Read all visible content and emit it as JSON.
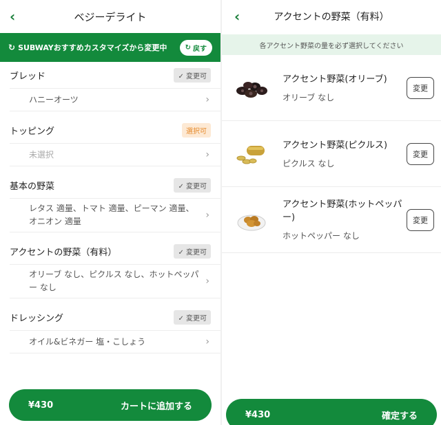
{
  "left": {
    "title": "ベジーデライト",
    "back_icon": "chevron-left-icon",
    "banner": {
      "icon": "refresh-icon",
      "text": "SUBWAYおすすめカスタマイズから変更中",
      "button_label": "戻す"
    },
    "sections": [
      {
        "label": "ブレッド",
        "badge": "✓ 変更可",
        "badge_style": "grey",
        "value": "ハニーオーツ"
      },
      {
        "label": "トッピング",
        "badge": "選択可",
        "badge_style": "orange",
        "value": "未選択"
      },
      {
        "label": "基本の野菜",
        "badge": "✓ 変更可",
        "badge_style": "grey",
        "value": "レタス 適量、トマト 適量、ピーマン 適量、オニオン 適量"
      },
      {
        "label": "アクセントの野菜（有料）",
        "badge": "✓ 変更可",
        "badge_style": "grey",
        "value": "オリーブ なし、ピクルス なし、ホットペッパー なし"
      },
      {
        "label": "ドレッシング",
        "badge": "✓ 変更可",
        "badge_style": "grey",
        "value": "オイル&ビネガー 塩・こしょう"
      }
    ],
    "cta": {
      "price": "¥430",
      "label": "カートに追加する"
    }
  },
  "right": {
    "title": "アクセントの野菜（有料）",
    "notice": "各アクセント野菜の量を必ず選択してください",
    "items": [
      {
        "name": "アクセント野菜(オリーブ)",
        "value": "オリーブ なし",
        "button": "変更",
        "icon": "olive-icon"
      },
      {
        "name": "アクセント野菜(ピクルス)",
        "value": "ピクルス なし",
        "button": "変更",
        "icon": "pickle-icon"
      },
      {
        "name": "アクセント野菜(ホットペッパー)",
        "value": "ホットペッパー なし",
        "button": "変更",
        "icon": "hot-pepper-icon"
      }
    ],
    "cta": {
      "price": "¥430",
      "label": "確定する"
    }
  },
  "colors": {
    "brand_green": "#138a3c",
    "notice_bg": "#e6f4ea",
    "badge_orange": "#e58a2c"
  }
}
